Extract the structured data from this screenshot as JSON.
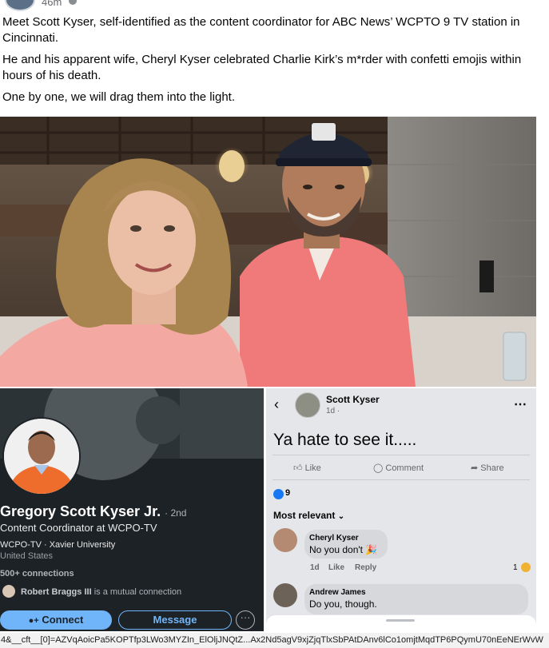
{
  "post": {
    "time": "46m",
    "paragraphs": [
      "Meet Scott Kyser, self-identified as the content coordinator for ABC News’ WCPTO 9 TV station in Cincinnati.",
      "He and his apparent wife, Cheryl Kyser celebrated Charlie Kirk’s m*rder with confetti emojis within hours of his death.",
      "One by one, we will drag them into the light."
    ]
  },
  "linkedin": {
    "name": "Gregory Scott Kyser Jr.",
    "degree": "· 2nd",
    "headline": "Content Coordinator at WCPO-TV",
    "company": "WCPO-TV · Xavier University",
    "location": "United States",
    "connections": "500+ connections",
    "mutual_name": "Robert Braggs III",
    "mutual_suffix": "is a mutual connection",
    "connect_label": "Connect",
    "message_label": "Message",
    "more_label": "···"
  },
  "fb_screenshot": {
    "author": "Scott Kyser",
    "time": "1d ·",
    "text": "Ya hate to see it.....",
    "like_label": "Like",
    "comment_label": "Comment",
    "share_label": "Share",
    "reaction_count": "9",
    "sort_label": "Most relevant",
    "comments": [
      {
        "name": "Cheryl Kyser",
        "text": "No you don't 🎉",
        "time": "1d",
        "like": "Like",
        "reply": "Reply",
        "reactions": "1"
      },
      {
        "name": "Andrew James",
        "text": "Do you, though."
      }
    ]
  },
  "statusbar": {
    "url": "4&__cft__[0]=AZVqAoicPa5KOPTfp3LWo3MYZIn_ElOljJNQtZ...Ax2Nd5agV9xjZjqTlxSbPAtDAnv6lCo1omjtMqdTP6PQymU70nEeNErWvW"
  },
  "colors": {
    "linkedin_bg": "#1d2226",
    "linkedin_accent": "#70b5f9",
    "facebook_blue": "#1877f2",
    "fb_panel_bg": "#e4e6e9"
  }
}
